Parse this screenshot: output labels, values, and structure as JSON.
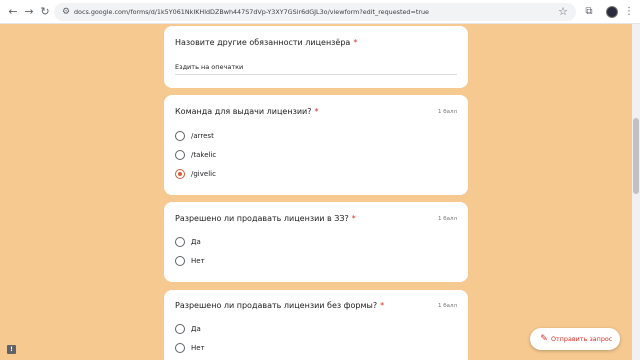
{
  "browser": {
    "url": "docs.google.com/forms/d/1k5Y061NkIKHldDZBwh447S7dVp-Y3XY7GSir6dGJL3o/viewform?edit_requested=true",
    "icons": {
      "back": "arrow-left-icon",
      "forward": "arrow-right-icon",
      "reload": "reload-icon",
      "site_info": "site-info-icon",
      "bookmark": "star-icon",
      "extensions": "puzzle-icon",
      "menu": "kebab-menu-icon"
    }
  },
  "theme": {
    "background": "#f5c98f",
    "accent": "#d95d39",
    "required": "#d93025"
  },
  "questions": [
    {
      "title": "Назовите другие обязанности лицензёра",
      "required_mark": "*",
      "answer": "Ездить на опечатки"
    },
    {
      "title": "Команда для выдачи лицензии?",
      "required_mark": "*",
      "points": "1 балл",
      "options": [
        "/arrest",
        "/takelic",
        "/givelic"
      ],
      "selected": "/givelic"
    },
    {
      "title": "Разрешено ли продавать лицензии в ЗЗ?",
      "required_mark": "*",
      "points": "1 балл",
      "options": [
        "Да",
        "Нет"
      ]
    },
    {
      "title": "Разрешено ли продавать лицензии без формы?",
      "required_mark": "*",
      "points": "1 балл",
      "options": [
        "Да",
        "Нет"
      ]
    }
  ],
  "send_request": {
    "label": "Отправить запрос",
    "icon": "pencil-icon"
  },
  "report_icon": "report-icon"
}
